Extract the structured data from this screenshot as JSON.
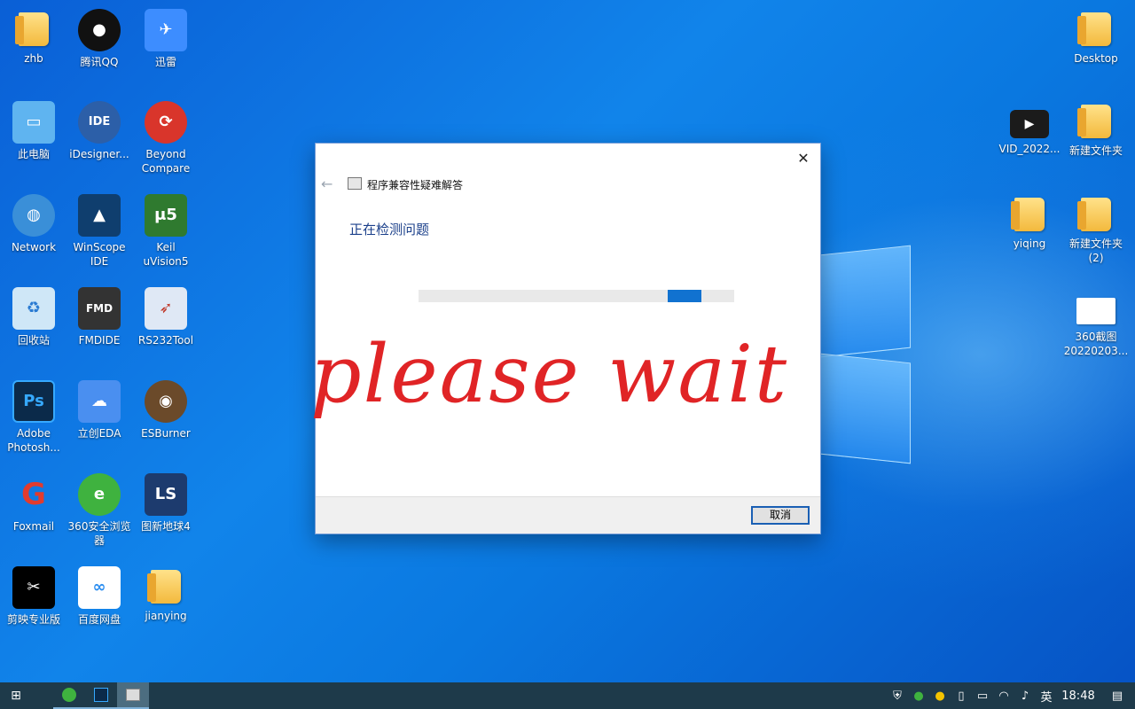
{
  "desktop": {
    "left_icons": [
      {
        "label": "zhb",
        "icon": "user-folder-icon"
      },
      {
        "label": "腾讯QQ",
        "icon": "qq-penguin-icon"
      },
      {
        "label": "迅雷",
        "icon": "xunlei-bird-icon"
      },
      {
        "label": "此电脑",
        "icon": "computer-icon"
      },
      {
        "label": "iDesigner...",
        "icon": "idesigner-icon"
      },
      {
        "label": "Beyond Compare",
        "icon": "beyond-compare-icon"
      },
      {
        "label": "Network",
        "icon": "network-icon"
      },
      {
        "label": "WinScope IDE",
        "icon": "winscope-icon"
      },
      {
        "label": "Keil uVision5",
        "icon": "keil-icon"
      },
      {
        "label": "回收站",
        "icon": "recycle-bin-icon"
      },
      {
        "label": "FMDIDE",
        "icon": "chip-icon"
      },
      {
        "label": "RS232Tool",
        "icon": "rocket-icon"
      },
      {
        "label": "Adobe Photosh...",
        "icon": "photoshop-icon"
      },
      {
        "label": "立创EDA",
        "icon": "cloud-icon"
      },
      {
        "label": "ESBurner",
        "icon": "owl-icon"
      },
      {
        "label": "Foxmail",
        "icon": "foxmail-icon"
      },
      {
        "label": "360安全浏览器",
        "icon": "browser-360-icon"
      },
      {
        "label": "图新地球4",
        "icon": "earth-app-icon"
      },
      {
        "label": "剪映专业版",
        "icon": "capcut-icon"
      },
      {
        "label": "百度网盘",
        "icon": "baidu-pan-icon"
      },
      {
        "label": "jianying",
        "icon": "folder-icon"
      }
    ],
    "right_icons": [
      {
        "label": "Desktop",
        "icon": "folder-icon"
      },
      {
        "label": "VID_2022...",
        "icon": "video-icon"
      },
      {
        "label": "新建文件夹",
        "icon": "folder-icon"
      },
      {
        "label": "yiqing",
        "icon": "folder-icon"
      },
      {
        "label": "新建文件夹 (2)",
        "icon": "folder-icon"
      },
      {
        "label": "360截图 20220203...",
        "icon": "image-file-icon"
      }
    ]
  },
  "dialog": {
    "title": "程序兼容性疑难解答",
    "heading": "正在检测问题",
    "progress_segment": {
      "start": 0.789,
      "length": 0.107
    },
    "cancel_label": "取消"
  },
  "overlay": {
    "text": "please wait",
    "color": "#e02426"
  },
  "taskbar": {
    "apps": [
      "browser-360-icon",
      "photoshop-icon",
      "troubleshooter-icon"
    ],
    "language": "英",
    "time": "18:48"
  }
}
